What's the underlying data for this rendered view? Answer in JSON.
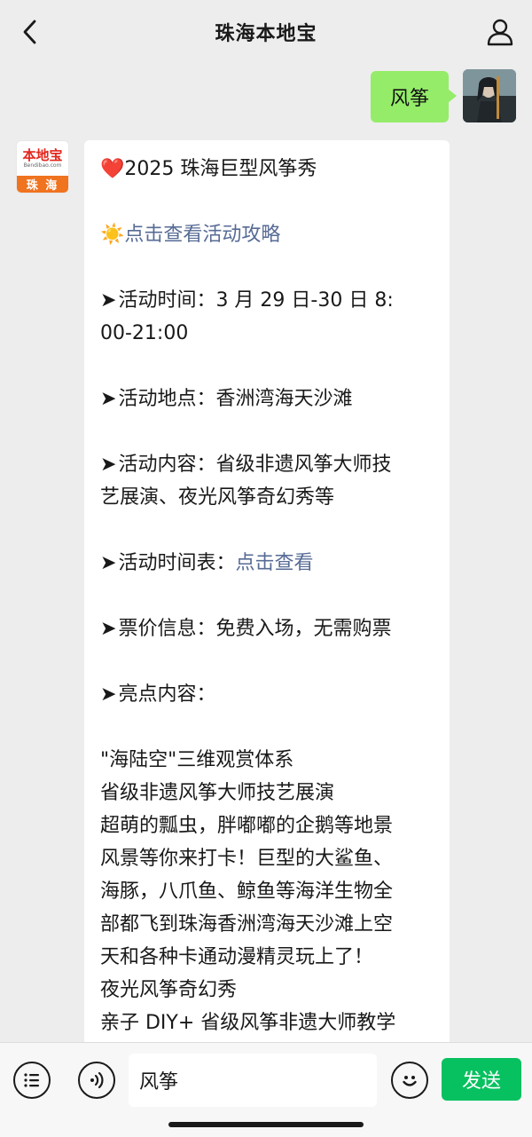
{
  "header": {
    "title": "珠海本地宝"
  },
  "outgoing_message": {
    "text": "风筝"
  },
  "incoming_avatar": {
    "brand_text": "本地宝",
    "brand_url": "Bendibao.com",
    "city_text": "珠 海"
  },
  "incoming_message": {
    "title_emoji": "❤️",
    "title_text": "2025 珠海巨型风筝秀",
    "guide_emoji": "☀️",
    "guide_link": "点击查看活动攻略",
    "arrow": "➤",
    "time_line1": "活动时间：3 月 29 日-30 日 8:",
    "time_line2": "00-21:00",
    "location": "活动地点：香洲湾海天沙滩",
    "content_line1": "活动内容：省级非遗风筝大师技",
    "content_line2": "艺展演、夜光风筝奇幻秀等",
    "schedule_label": "活动时间表：",
    "schedule_link": "点击查看",
    "ticket": "票价信息：免费入场，无需购票",
    "highlights_label": "亮点内容：",
    "highlights": [
      "\"海陆空\"三维观赏体系",
      "省级非遗风筝大师技艺展演",
      "超萌的瓢虫，胖嘟嘟的企鹅等地景",
      "风景等你来打卡！巨型的大鲨鱼、",
      "海豚，八爪鱼、鲸鱼等海洋生物全",
      "部都飞到珠海香洲湾海天沙滩上空",
      "天和各种卡通动漫精灵玩上了！",
      "夜光风筝奇幻秀",
      "亲子 DIY+ 省级风筝非遗大师教学"
    ]
  },
  "input_bar": {
    "input_value": "风筝",
    "send_label": "发送"
  },
  "colors": {
    "background": "#ededed",
    "outgoing_bubble": "#95ec69",
    "link": "#576b95",
    "send_button": "#07c160"
  }
}
